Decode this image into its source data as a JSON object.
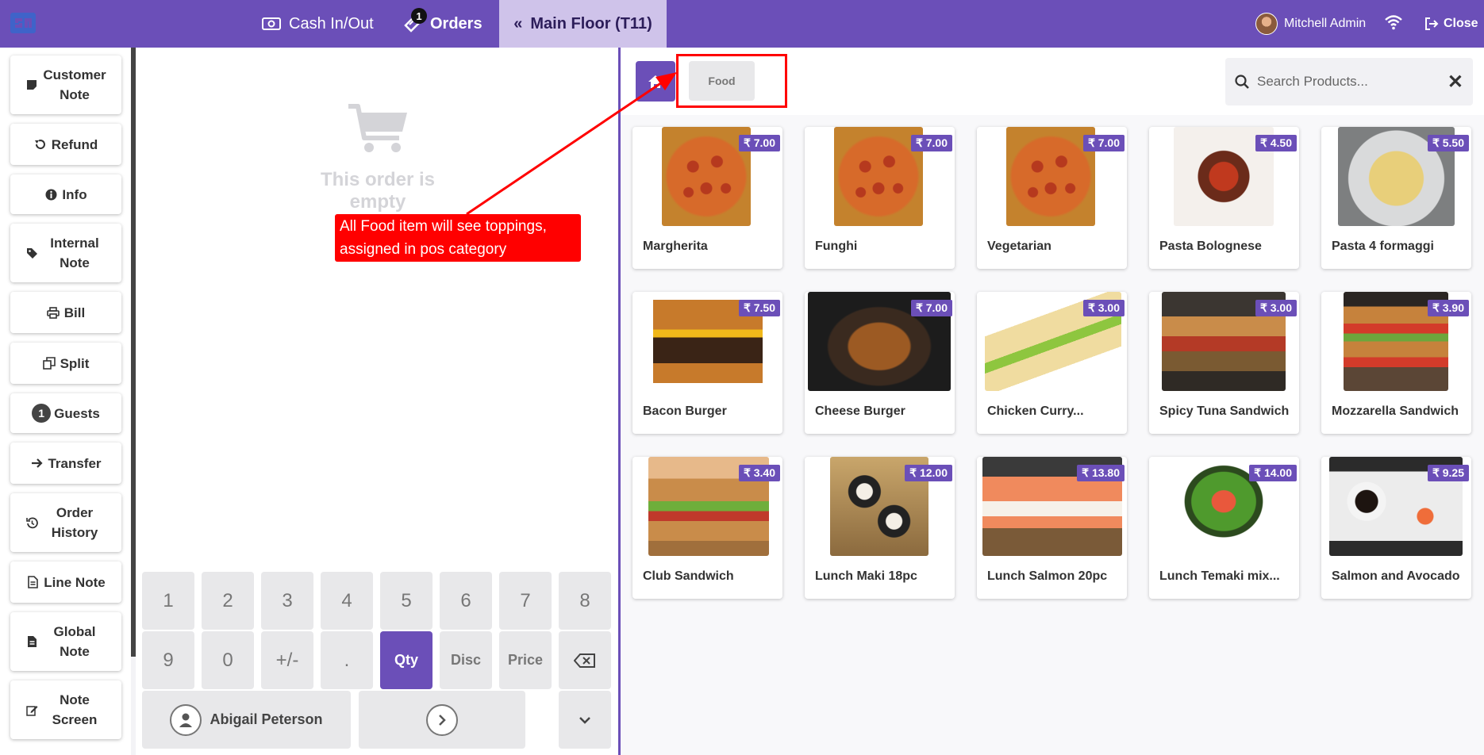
{
  "topbar": {
    "cash_label": "Cash In/Out",
    "orders_label": "Orders",
    "orders_badge": "1",
    "floor_label": "Main Floor (T11)",
    "user_name": "Mitchell Admin",
    "close_label": "Close",
    "accent": "#6b4fb8"
  },
  "actions": [
    {
      "label": "Customer Note",
      "icon": "sticky-note-icon"
    },
    {
      "label": "Refund",
      "icon": "undo-icon"
    },
    {
      "label": "Info",
      "icon": "info-circle-icon"
    },
    {
      "label": "Internal Note",
      "icon": "tag-icon"
    },
    {
      "label": "Bill",
      "icon": "print-icon"
    },
    {
      "label": "Split",
      "icon": "copy-icon"
    },
    {
      "label": "Guests",
      "icon": "guests-badge",
      "badge": "1"
    },
    {
      "label": "Transfer",
      "icon": "arrow-right-icon"
    },
    {
      "label": "Order History",
      "icon": "history-icon"
    },
    {
      "label": "Line Note",
      "icon": "file-icon"
    },
    {
      "label": "Global Note",
      "icon": "file-text-icon"
    },
    {
      "label": "Note Screen",
      "icon": "edit-icon"
    }
  ],
  "order": {
    "empty_text": "This order is empty"
  },
  "numpad": {
    "row1": [
      "1",
      "2",
      "3",
      "4",
      "5",
      "6",
      "7",
      "8"
    ],
    "row2": [
      "9",
      "0",
      "+/-",
      ".",
      "Qty",
      "Disc",
      "Price"
    ],
    "customer_label": "Abigail Peterson"
  },
  "categories": {
    "food_label": "Food"
  },
  "search": {
    "placeholder": "Search Products..."
  },
  "products": [
    {
      "name": "Margherita",
      "price": "₹ 7.00"
    },
    {
      "name": "Funghi",
      "price": "₹ 7.00"
    },
    {
      "name": "Vegetarian",
      "price": "₹ 7.00"
    },
    {
      "name": "Pasta Bolognese",
      "price": "₹ 4.50"
    },
    {
      "name": "Pasta 4 formaggi",
      "price": "₹ 5.50"
    },
    {
      "name": "Bacon Burger",
      "price": "₹ 7.50"
    },
    {
      "name": "Cheese Burger",
      "price": "₹ 7.00"
    },
    {
      "name": "Chicken Curry...",
      "price": "₹ 3.00"
    },
    {
      "name": "Spicy Tuna Sandwich",
      "price": "₹ 3.00"
    },
    {
      "name": "Mozzarella Sandwich",
      "price": "₹ 3.90"
    },
    {
      "name": "Club Sandwich",
      "price": "₹ 3.40"
    },
    {
      "name": "Lunch Maki 18pc",
      "price": "₹ 12.00"
    },
    {
      "name": "Lunch Salmon 20pc",
      "price": "₹ 13.80"
    },
    {
      "name": "Lunch Temaki mix...",
      "price": "₹ 14.00"
    },
    {
      "name": "Salmon and Avocado",
      "price": "₹ 9.25"
    }
  ],
  "annotation": {
    "line1": "All Food item will see toppings,",
    "line2": "assigned in pos category",
    "color": "#ff0000"
  }
}
